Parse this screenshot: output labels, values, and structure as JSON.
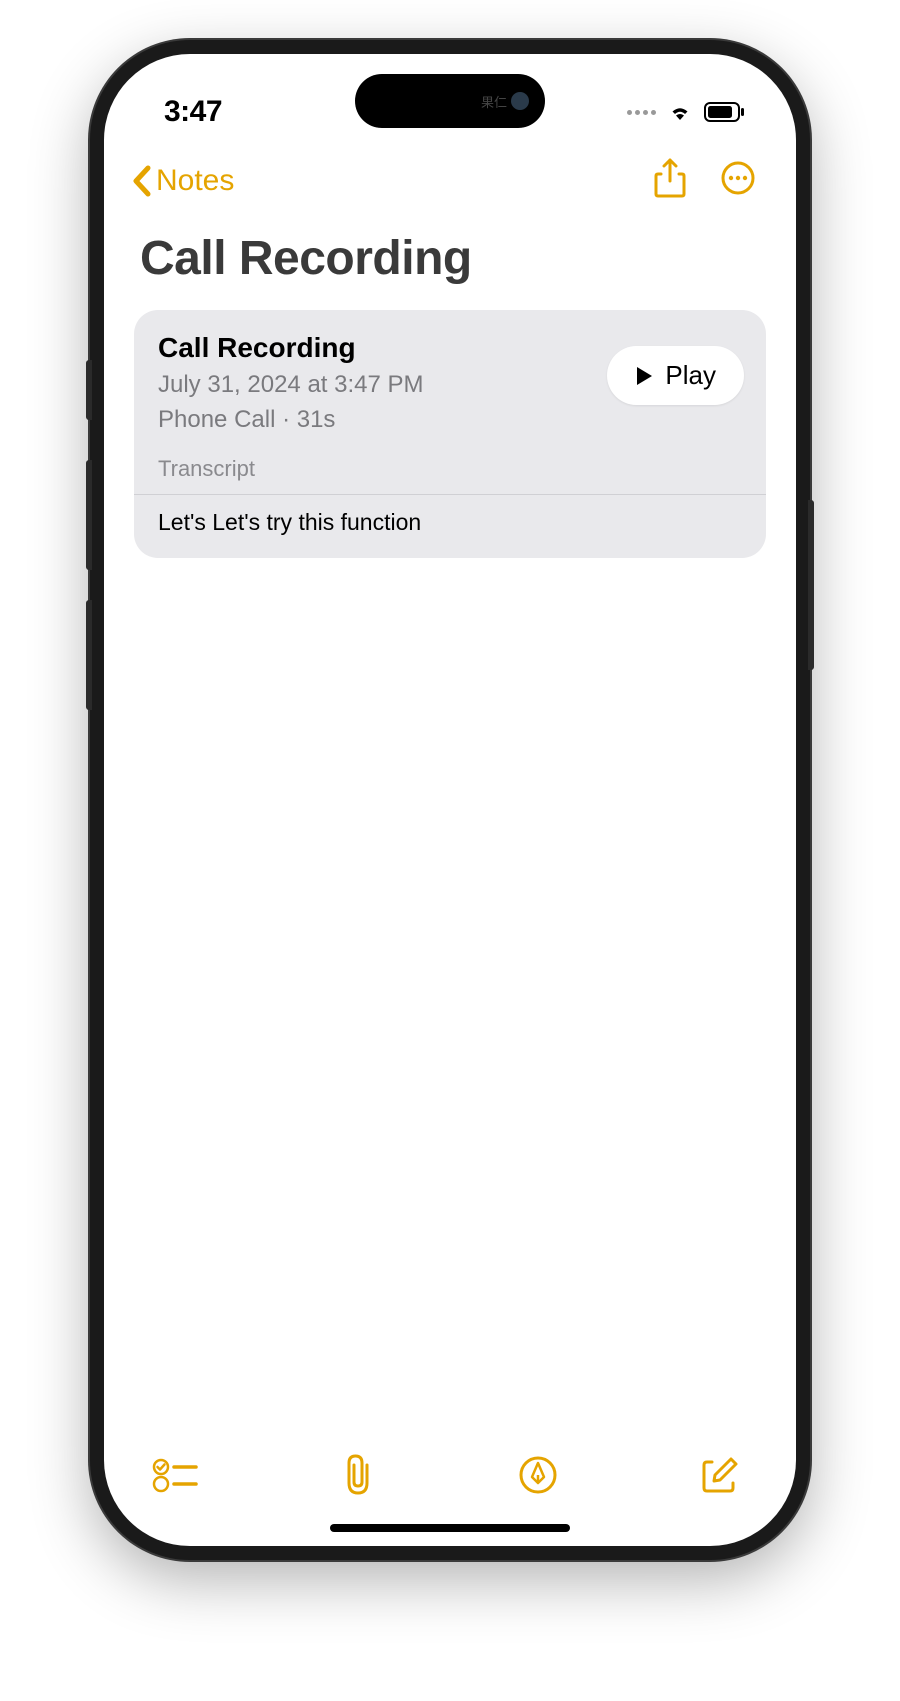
{
  "status": {
    "time": "3:47",
    "island_text": "果仁"
  },
  "nav": {
    "back_label": "Notes"
  },
  "note": {
    "title": "Call Recording",
    "watermark": "July 31, 2024 at 3:47 PM"
  },
  "card": {
    "title": "Call Recording",
    "timestamp": "July 31, 2024 at 3:47 PM",
    "meta": "Phone Call · 31s",
    "play_label": "Play",
    "transcript_label": "Transcript",
    "transcript_text": "Let's Let's try this function"
  }
}
